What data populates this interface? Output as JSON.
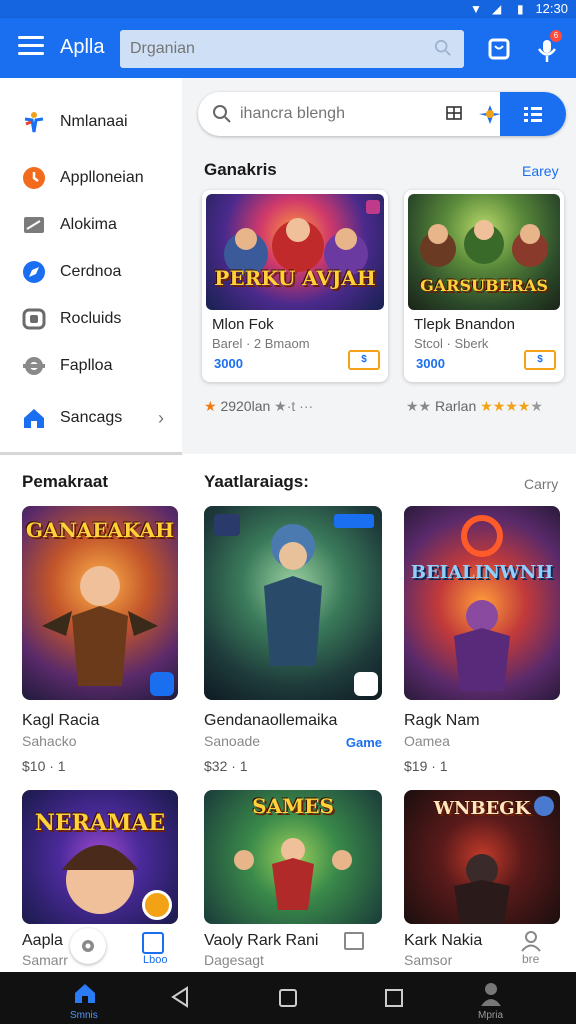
{
  "status_bar": {
    "time": "12:30"
  },
  "app_bar": {
    "title": "Aplla",
    "search_placeholder": "Drganian",
    "notification_count": "6"
  },
  "drawer": {
    "items": [
      {
        "label": "Nmlanaai",
        "icon": "star-person-icon"
      },
      {
        "label": "Applloneian",
        "icon": "clock-orange-icon"
      },
      {
        "label": "Alokima",
        "icon": "card-icon"
      },
      {
        "label": "Cerdnoa",
        "icon": "compass-icon"
      },
      {
        "label": "Rocluids",
        "icon": "rounded-square-icon"
      },
      {
        "label": "Faplloa",
        "icon": "gear-blob-icon"
      },
      {
        "label": "Sancags",
        "icon": "home-icon"
      }
    ]
  },
  "search": {
    "placeholder": "ihancra blengh"
  },
  "featured": {
    "title": "Ganakris",
    "see_all": "Earey",
    "cards": [
      {
        "art_title": "PERKU AVJAH",
        "name": "Mlon Fok",
        "sub": "Barel · 2 Bmaom",
        "price": "3000",
        "tag": "$"
      },
      {
        "art_title": "GARSUBERAS",
        "name": "Tlepk Bnandon",
        "sub": "Stcol · Sberk",
        "price": "3000",
        "tag": "$"
      }
    ],
    "meta_left": "2920lan",
    "meta_left_extra": "★·t ···",
    "meta_right": "Rarlan"
  },
  "popular": {
    "left_title": "Pemakraat",
    "mid_title": "Yaatlaraiags:",
    "see_all": "Carry",
    "games": [
      {
        "art_title": "GANAEAKAH",
        "name": "Kagl Racia",
        "dev": "Sahacko",
        "price": "$10 · 1",
        "tag": ""
      },
      {
        "art_title": "",
        "name": "Gendanaollemaika",
        "dev": "Sanoade",
        "price": "$32 · 1",
        "tag": "Game"
      },
      {
        "art_title": "BEIALINWNH",
        "name": "Ragk Nam",
        "dev": "Oamea",
        "price": "$19 · 1",
        "tag": ""
      }
    ]
  },
  "more_games": [
    {
      "art_title": "NERAMAE",
      "name": "Aapla",
      "dev": "Samarr"
    },
    {
      "art_title": "SAMES",
      "name": "Vaoly Rark Rani",
      "dev": "Dagesagt"
    },
    {
      "art_title": "WNBEGK",
      "name": "Kark Nakia",
      "dev": "Samsor"
    }
  ],
  "bottom_tabs": {
    "center_label": "Lboo",
    "right_label": "bre"
  },
  "nav_bar": {
    "home_label": "Smnis",
    "profile_label": "Mpria"
  },
  "colors": {
    "primary": "#1a6ff0",
    "price_border": "#f2a214",
    "navbar": "#111111"
  }
}
